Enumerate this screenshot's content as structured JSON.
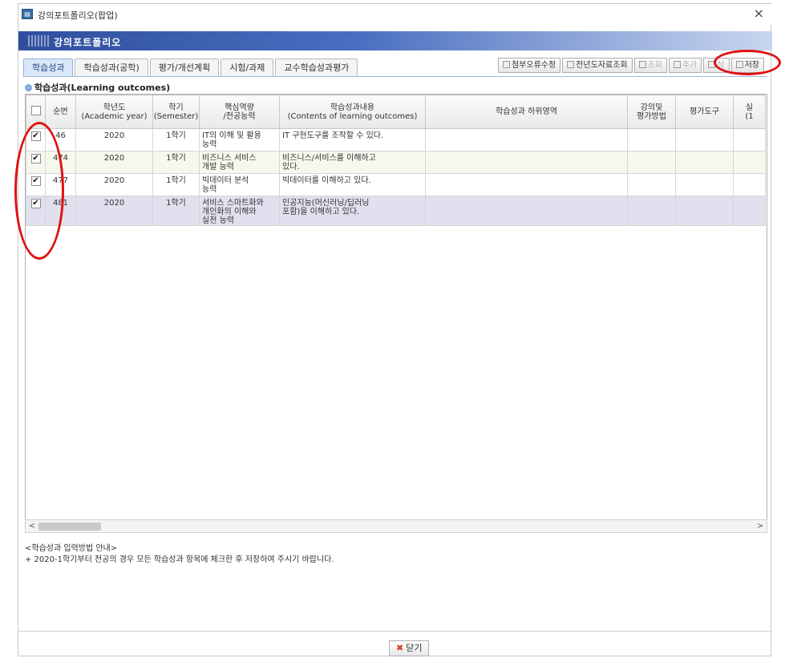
{
  "window": {
    "title": "강의포트폴리오(팝업)",
    "close_glyph": "×"
  },
  "banner": {
    "title": "강의포트폴리오"
  },
  "tabs": [
    "학습성과",
    "학습성과(공학)",
    "평가/개선계획",
    "시험/과제",
    "교수학습성과평가"
  ],
  "toolbar": {
    "buttons": [
      {
        "label": "첨부오류수정",
        "disabled": false
      },
      {
        "label": "전년도자료조회",
        "disabled": false
      },
      {
        "label": "조회",
        "disabled": true
      },
      {
        "label": "추가",
        "disabled": true
      },
      {
        "label": "삭",
        "disabled": true
      },
      {
        "label": "저장",
        "disabled": false
      }
    ]
  },
  "section": {
    "title": "학습성과(Learning outcomes)"
  },
  "table": {
    "headers": [
      "",
      "순번",
      "학년도\n(Academic year)",
      "학기\n(Semester)",
      "핵심역량\n/전공능력",
      "학습성과내용\n(Contents of learning outcomes)",
      "학습성과 하위영역",
      "강의및\n평가방법",
      "평가도구",
      "실\n(1"
    ],
    "rows": [
      {
        "checked": true,
        "no": "46",
        "year": "2020",
        "semester": "1학기",
        "competency": "IT의 이해 및 활용\n능력",
        "content": "IT 구현도구를 조작할 수 있다.",
        "sub": "",
        "method": "",
        "tool": "",
        "extra": ""
      },
      {
        "checked": true,
        "no": "474",
        "year": "2020",
        "semester": "1학기",
        "competency": "비즈니스 서비스\n개발 능력",
        "content": "비즈니스/서비스를 이해하고\n있다.",
        "sub": "",
        "method": "",
        "tool": "",
        "extra": ""
      },
      {
        "checked": true,
        "no": "477",
        "year": "2020",
        "semester": "1학기",
        "competency": "빅데이터 분석\n능력",
        "content": "빅데이터를 이해하고 있다.",
        "sub": "",
        "method": "",
        "tool": "",
        "extra": ""
      },
      {
        "checked": true,
        "no": "481",
        "year": "2020",
        "semester": "1학기",
        "competency": "서비스 스마트화와\n개인화의 이해와\n실천 능력",
        "content": "인공지능(머신러닝/딥러닝\n포함)을 이해하고 있다.",
        "sub": "",
        "method": "",
        "tool": "",
        "extra": ""
      }
    ]
  },
  "scroll": {
    "left_arrow": "<",
    "right_arrow": ">"
  },
  "notes": {
    "line1": "<학습성과 입력방법 안내>",
    "line2": "+ 2020-1학기부터 전공의 경우 모든 학습성과 항목에 체크한 후 저장하여 주시기 바랍니다."
  },
  "footer": {
    "close_icon": "✖",
    "close_label": "닫기"
  },
  "colors": {
    "banner": "#2f4f9e",
    "annotation": "#e01010",
    "selected_row": "#e0e0ee"
  }
}
